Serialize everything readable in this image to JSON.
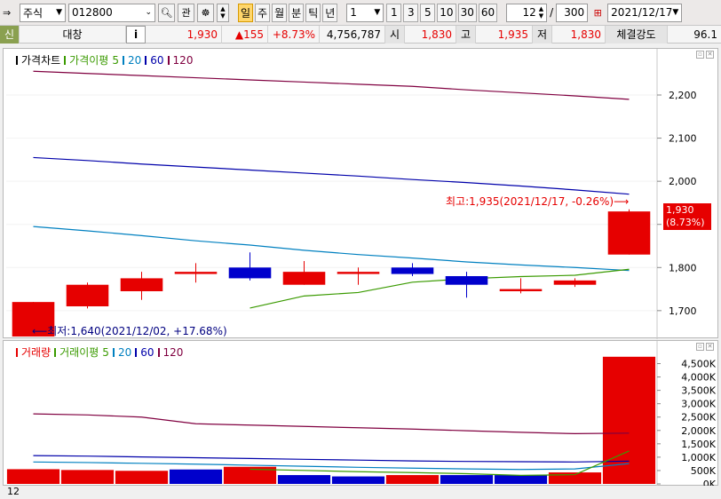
{
  "toolbar": {
    "market": "주식",
    "code": "012800",
    "watch_label": "관",
    "periods": [
      "일",
      "주",
      "월",
      "분",
      "틱",
      "년"
    ],
    "active_period": "일",
    "interval": "1",
    "quick_intervals": [
      "1",
      "3",
      "5",
      "10",
      "30",
      "60"
    ],
    "count": "12",
    "total": "300",
    "date": "2021/12/17"
  },
  "quote": {
    "badge": "신",
    "name": "대창",
    "info_label": "i",
    "price": "1,930",
    "change": "▲155",
    "change_pct": "+8.73%",
    "volume": "4,756,787",
    "open_label": "시",
    "open": "1,830",
    "high_label": "고",
    "high": "1,935",
    "low_label": "저",
    "low": "1,830",
    "strength_label": "체결강도",
    "strength": "96.1"
  },
  "price_panel": {
    "title": "가격차트",
    "ma_label": "가격이평",
    "ma_periods": [
      "5",
      "20",
      "60",
      "120"
    ],
    "high_note": "최고:1,935(2021/12/17, -0.26%)⟶",
    "low_note": "⟵최저:1,640(2021/12/02, +17.68%)",
    "last_tag": [
      "1,930",
      "(8.73%)"
    ]
  },
  "volume_panel": {
    "title": "거래량",
    "ma_label": "거래이평",
    "ma_periods": [
      "5",
      "20",
      "60",
      "120"
    ]
  },
  "colors": {
    "up": "#e60000",
    "down": "#0000cc",
    "ma5": "#3a9a00",
    "ma20": "#0080c0",
    "ma60": "#0000aa",
    "ma120": "#800040"
  },
  "chart_data": [
    {
      "type": "candlestick",
      "title": "가격차트",
      "ylim": [
        1640,
        2270
      ],
      "y_ticks": [
        1700,
        1800,
        1900,
        2000,
        2100,
        2200
      ],
      "y_tick_labels": [
        "1,700",
        "1,800",
        "1,900",
        "2,000",
        "2,100",
        "2,200"
      ],
      "candles": [
        {
          "o": 1640,
          "h": 1720,
          "l": 1640,
          "c": 1720
        },
        {
          "o": 1710,
          "h": 1765,
          "l": 1705,
          "c": 1760
        },
        {
          "o": 1745,
          "h": 1790,
          "l": 1725,
          "c": 1775
        },
        {
          "o": 1785,
          "h": 1810,
          "l": 1765,
          "c": 1790
        },
        {
          "o": 1800,
          "h": 1835,
          "l": 1770,
          "c": 1775
        },
        {
          "o": 1760,
          "h": 1815,
          "l": 1760,
          "c": 1790
        },
        {
          "o": 1785,
          "h": 1800,
          "l": 1760,
          "c": 1790
        },
        {
          "o": 1800,
          "h": 1810,
          "l": 1780,
          "c": 1785
        },
        {
          "o": 1780,
          "h": 1790,
          "l": 1730,
          "c": 1760
        },
        {
          "o": 1745,
          "h": 1775,
          "l": 1740,
          "c": 1750
        },
        {
          "o": 1760,
          "h": 1775,
          "l": 1755,
          "c": 1770
        },
        {
          "o": 1830,
          "h": 1935,
          "l": 1830,
          "c": 1930
        }
      ],
      "ma": [
        {
          "name": "5",
          "values": [
            null,
            null,
            null,
            null,
            1706,
            1734,
            1742,
            1766,
            1774,
            1779,
            1782,
            1796
          ]
        },
        {
          "name": "20",
          "values": [
            1895,
            1885,
            1874,
            1862,
            1852,
            1840,
            1830,
            1822,
            1813,
            1806,
            1800,
            1793
          ]
        },
        {
          "name": "60",
          "values": [
            2055,
            2048,
            2040,
            2033,
            2026,
            2019,
            2012,
            2004,
            1997,
            1989,
            1980,
            1970
          ]
        },
        {
          "name": "120",
          "values": [
            2255,
            2250,
            2245,
            2240,
            2235,
            2230,
            2225,
            2220,
            2212,
            2205,
            2198,
            2190
          ]
        }
      ]
    },
    {
      "type": "bar",
      "title": "거래량",
      "ylim": [
        0,
        4750000
      ],
      "y_ticks": [
        0,
        500000,
        1000000,
        1500000,
        2000000,
        2500000,
        3000000,
        3500000,
        4000000,
        4500000
      ],
      "y_tick_labels": [
        "0K",
        "500K",
        "1,000K",
        "1,500K",
        "2,000K",
        "2,500K",
        "3,000K",
        "3,500K",
        "4,000K",
        "4,500K"
      ],
      "values": [
        550000,
        520000,
        490000,
        540000,
        640000,
        330000,
        280000,
        330000,
        330000,
        330000,
        430000,
        4756787
      ],
      "up": [
        true,
        true,
        true,
        false,
        true,
        false,
        false,
        true,
        false,
        false,
        true,
        true
      ],
      "ma": [
        {
          "name": "5",
          "values": [
            null,
            null,
            null,
            null,
            548000,
            504000,
            456000,
            424000,
            382000,
            320000,
            346000,
            1232000
          ]
        },
        {
          "name": "20",
          "values": [
            820000,
            800000,
            770000,
            740000,
            700000,
            660000,
            620000,
            590000,
            560000,
            540000,
            560000,
            760000
          ]
        },
        {
          "name": "60",
          "values": [
            1060000,
            1040000,
            1010000,
            980000,
            950000,
            920000,
            890000,
            860000,
            840000,
            830000,
            820000,
            850000
          ]
        },
        {
          "name": "120",
          "values": [
            2620000,
            2580000,
            2500000,
            2250000,
            2200000,
            2150000,
            2100000,
            2050000,
            1990000,
            1930000,
            1880000,
            1900000
          ]
        }
      ]
    }
  ],
  "status": {
    "count": "12"
  }
}
